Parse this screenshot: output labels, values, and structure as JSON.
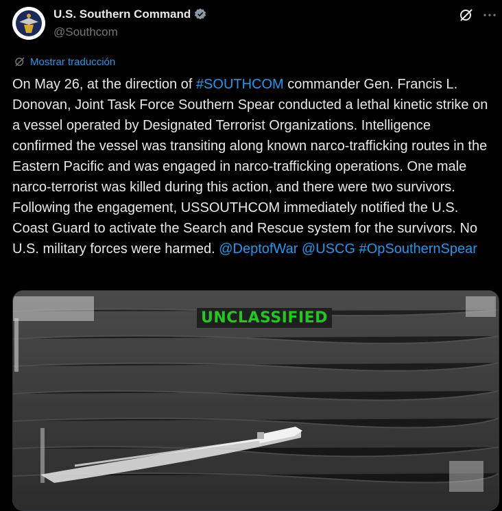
{
  "account": {
    "name": "U.S. Southern Command",
    "handle": "@Southcom",
    "avatar_icon": "southcom-seal",
    "verified_icon": "verified-badge-icon"
  },
  "actions": {
    "grok_icon": "grok-icon",
    "more_icon": "more-options-icon"
  },
  "translate": {
    "label": "Mostrar traducción",
    "icon": "translate-icon"
  },
  "tweet": {
    "text_1": "On May 26, at the direction of ",
    "hashtag_southcom": "#SOUTHCOM",
    "text_2": " commander Gen. Francis L. Donovan, Joint Task Force Southern Spear conducted a lethal kinetic strike on a vessel operated by Designated Terrorist Organizations. Intelligence confirmed the vessel was transiting along known narco-trafficking routes in the Eastern Pacific and was engaged in narco-trafficking operations. One male narco-terrorist was killed during this action, and there were two survivors. Following the engagement, USSOUTHCOM immediately notified the U.S. Coast Guard to activate the Search and Rescue system for the survivors. No U.S. military forces were harmed. ",
    "mention_war": "@DeptofWar",
    "mention_uscg": "@USCG",
    "hashtag_op": "#OpSouthernSpear"
  },
  "media": {
    "overlay_label": "UNCLASSIFIED"
  },
  "colors": {
    "background": "#000000",
    "text": "#e7e9ea",
    "muted": "#71767b",
    "link": "#1d9bf0",
    "overlay_green": "#22c722"
  }
}
